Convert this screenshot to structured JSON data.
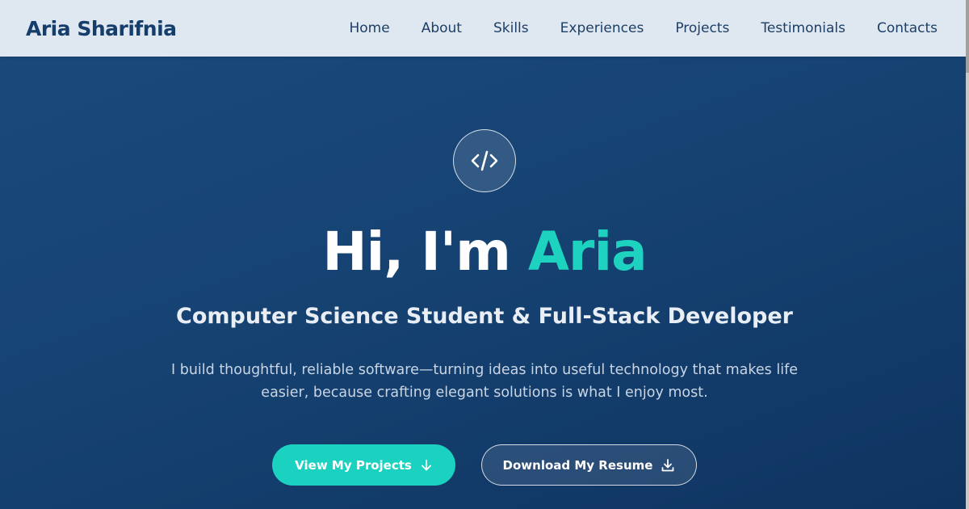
{
  "nav": {
    "brand": "Aria Sharifnia",
    "links": [
      "Home",
      "About",
      "Skills",
      "Experiences",
      "Projects",
      "Testimonials",
      "Contacts"
    ]
  },
  "hero": {
    "icon": "code-icon",
    "greeting_prefix": "Hi, I'm ",
    "greeting_name": "Aria",
    "subtitle": "Computer Science Student & Full-Stack Developer",
    "description": "I build thoughtful, reliable software—turning ideas into useful technology that makes life easier, because crafting elegant solutions is what I enjoy most.",
    "primary_button": {
      "label": "View My Projects",
      "icon": "arrow-down-icon"
    },
    "secondary_button": {
      "label": "Download My Resume",
      "icon": "download-icon"
    }
  },
  "colors": {
    "accent": "#1dd3c0",
    "nav_background": "#dfe7f0",
    "hero_background": "#164373",
    "brand_text": "#163e6b"
  }
}
